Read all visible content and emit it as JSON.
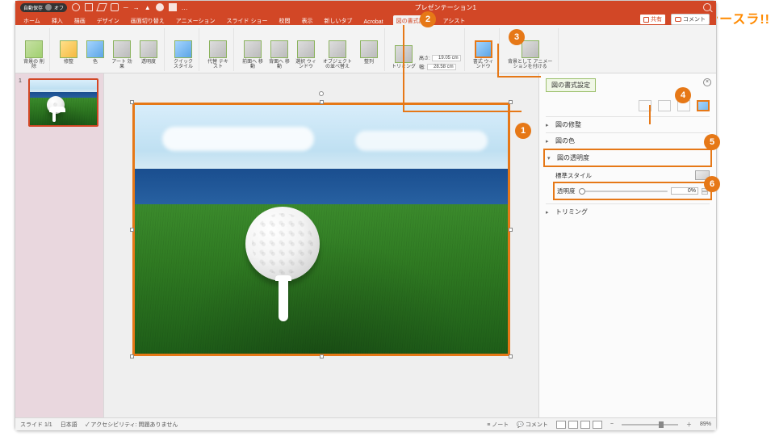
{
  "brand": "シースラ!!",
  "titlebar": {
    "autosave": "自動保存",
    "autosave_state": "オフ",
    "doc_title": "プレゼンテーション1"
  },
  "tabs": {
    "items": [
      "ホーム",
      "挿入",
      "描画",
      "デザイン",
      "画面切り替え",
      "アニメーション",
      "スライド ショー",
      "校閲",
      "表示",
      "新しいタブ",
      "Acrobat"
    ],
    "active": "図の書式設定",
    "assist": "アシスト",
    "share": "共有",
    "comments": "コメント"
  },
  "ribbon": {
    "g1": "背景の\n削除",
    "g2": "修整",
    "g3": "色",
    "g4": "アート\n効果",
    "g5": "透明度",
    "g6": "クイック\nスタイル",
    "g7": "代替\nテキスト",
    "g8": "前面へ\n移動",
    "g9": "背面へ\n移動",
    "g10": "選択\nウィンドウ",
    "g11": "オブジェクト\nの並べ替え",
    "g12": "整列",
    "g13": "トリミング",
    "size_h_label": "高さ:",
    "size_w_label": "幅:",
    "size_h": "19.05 cm",
    "size_w": "28.58 cm",
    "g14": "書式\nウィンドウ",
    "g15": "背景として\nアニメーションを付ける"
  },
  "pane": {
    "title": "図の書式設定",
    "sec1": "図の修整",
    "sec2": "図の色",
    "sec3": "図の透明度",
    "sec4": "トリミング",
    "preset_label": "標準スタイル",
    "trans_label": "透明度",
    "trans_value": "0%"
  },
  "status": {
    "slide": "スライド 1/1",
    "lang": "日本語",
    "a11y": "アクセシビリティ: 問題ありません",
    "notes": "ノート",
    "comments": "コメント",
    "zoom": "89%"
  },
  "thumb_num": "1",
  "callouts": {
    "c1": "1",
    "c2": "2",
    "c3": "3",
    "c4": "4",
    "c5": "5",
    "c6": "6"
  }
}
